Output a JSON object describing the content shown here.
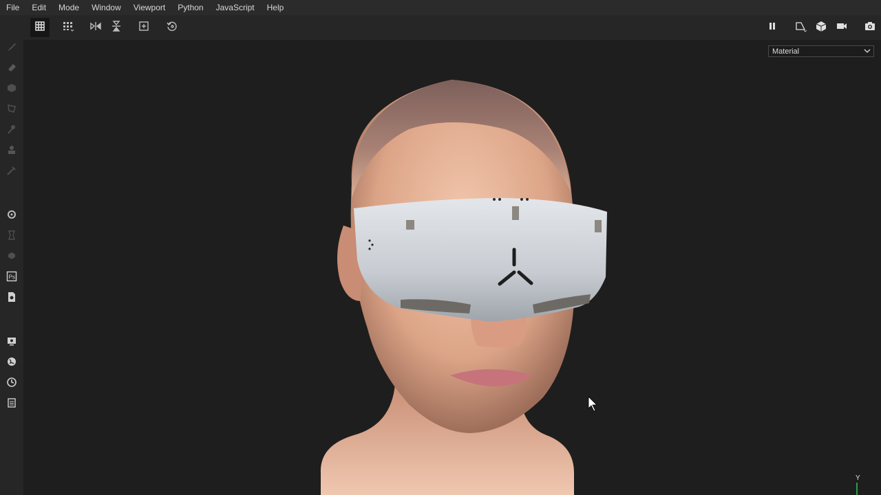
{
  "menu": {
    "items": [
      "File",
      "Edit",
      "Mode",
      "Window",
      "Viewport",
      "Python",
      "JavaScript",
      "Help"
    ]
  },
  "toolbar": {
    "left_icons": [
      "select-grid-icon",
      "grid-dropdown-icon",
      "mirror-x-icon",
      "mirror-y-icon",
      "add-frame-icon",
      "reset-icon"
    ],
    "right_icons": [
      "pause-icon",
      "perspective-icon",
      "cube-icon",
      "camera-icon",
      "screenshot-icon"
    ]
  },
  "left_tools": [
    "brush-icon",
    "eraser-icon",
    "projection-icon",
    "polyfill-icon",
    "smudge-icon",
    "clone-icon",
    "picker-icon",
    "settings-icon",
    "bake-icon",
    "material-icon",
    "photoshop-icon",
    "export-icon",
    "display-icon",
    "environment-icon",
    "history-icon",
    "log-icon"
  ],
  "viewport": {
    "display_mode": "Material",
    "axis_label": "Y"
  },
  "colors": {
    "accent": "#2e9a4a",
    "background": "#1e1e1e"
  }
}
